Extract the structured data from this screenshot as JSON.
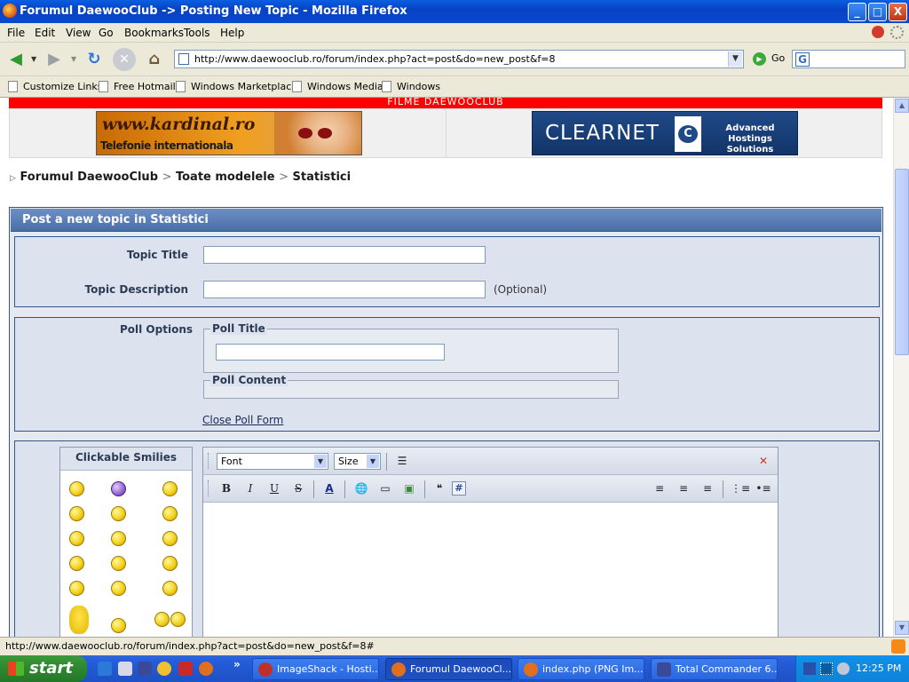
{
  "window": {
    "title": "Forumul DaewooClub -> Posting New Topic - Mozilla Firefox",
    "min": "_",
    "max": "□",
    "close": "X"
  },
  "menu": [
    "File",
    "Edit",
    "View",
    "Go",
    "Bookmarks",
    "Tools",
    "Help"
  ],
  "navbar": {
    "url": "http://www.daewooclub.ro/forum/index.php?act=post&do=new_post&f=8",
    "go_label": "Go"
  },
  "bookmarks": [
    "Customize Links",
    "Free Hotmail",
    "Windows Marketplace",
    "Windows Media",
    "Windows"
  ],
  "page": {
    "top_strip": "FILME DAEWOOCLUB",
    "banner_left": {
      "line1": "www.kardinal.ro",
      "line2": "Telefonie internationala"
    },
    "banner_right": {
      "brand": "CLEARNET",
      "tagline": "Advanced Hostings Solutions"
    },
    "breadcrumb": {
      "level1": "Forumul DaewooClub",
      "level2": "Toate modelele",
      "level3": "Statistici",
      "sep": ">"
    },
    "form": {
      "header": "Post a new topic in Statistici",
      "topic_title_label": "Topic Title",
      "topic_title_value": "",
      "topic_desc_label": "Topic Description",
      "topic_desc_value": "",
      "optional": "(Optional)",
      "poll_options_label": "Poll Options",
      "poll_title_legend": "Poll Title",
      "poll_title_value": "",
      "poll_content_legend": "Poll Content",
      "close_poll": "Close Poll Form"
    },
    "smilies": {
      "title": "Clickable Smilies"
    },
    "editor": {
      "font_select": "Font",
      "size_select": "Size",
      "bold": "B",
      "italic": "I",
      "underline": "U",
      "strike": "S",
      "color": "A",
      "hash": "#"
    }
  },
  "status": {
    "text": "http://www.daewooclub.ro/forum/index.php?act=post&do=new_post&f=8#"
  },
  "taskbar": {
    "start": "start",
    "overflow": "»",
    "tasks": [
      "ImageShack - Hosti...",
      "Forumul DaewooCl...",
      "index.php (PNG Im...",
      "Total Commander 6...."
    ],
    "clock": "12:25 PM"
  },
  "colors": {
    "titlebar": "#0842c4",
    "form_header": "#4a6fa8",
    "top_strip": "#ff0000",
    "start_button": "#2f8a2f"
  }
}
